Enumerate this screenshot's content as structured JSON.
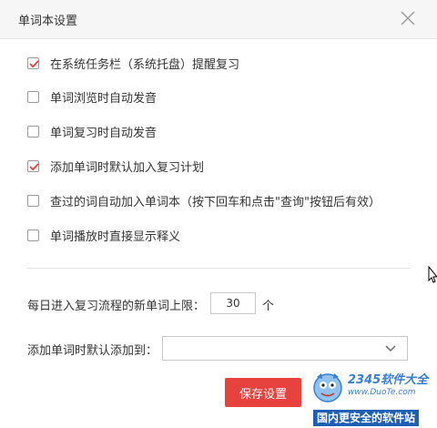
{
  "dialog": {
    "title": "单词本设置"
  },
  "options": [
    {
      "label": "在系统任务栏（系统托盘）提醒复习",
      "checked": true
    },
    {
      "label": "单词浏览时自动发音",
      "checked": false
    },
    {
      "label": "单词复习时自动发音",
      "checked": false
    },
    {
      "label": "添加单词时默认加入复习计划",
      "checked": true
    },
    {
      "label": "查过的词自动加入单词本（按下回车和点击\"查询\"按钮后有效）",
      "checked": false
    },
    {
      "label": "单词播放时直接显示释义",
      "checked": false
    }
  ],
  "daily_limit": {
    "label": "每日进入复习流程的新单词上限：",
    "value": "30",
    "unit": "个"
  },
  "default_wordbook": {
    "label": "添加单词时默认添加到：",
    "value": ""
  },
  "save_button": {
    "label": "保存设置"
  },
  "watermark": {
    "brand": "2345软件大全",
    "url": "www.DuoTe.com",
    "slogan": "国内更安全的软件站"
  },
  "colors": {
    "accent": "#e8423f",
    "header_bg": "#f6f6f6",
    "watermark_blue": "#1e5fb5"
  }
}
